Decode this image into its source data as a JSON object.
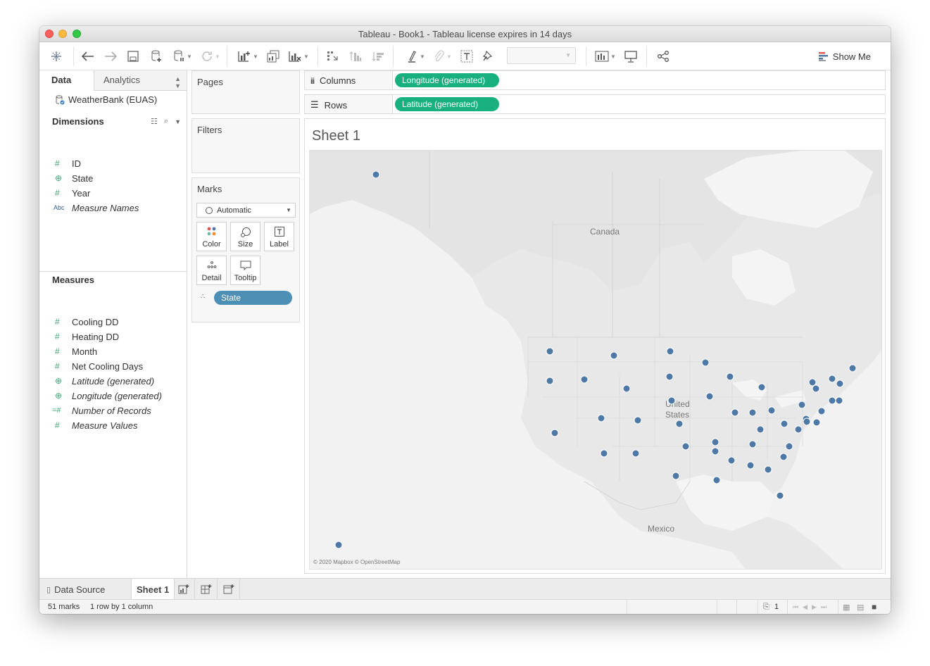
{
  "window": {
    "title": "Tableau - Book1 - Tableau license expires in 14 days"
  },
  "toolbar": {
    "show_me_label": "Show Me"
  },
  "datapane": {
    "tabs": {
      "data": "Data",
      "analytics": "Analytics"
    },
    "source": "WeatherBank (EUAS)",
    "dimensions_title": "Dimensions",
    "dimensions": [
      {
        "label": "ID",
        "icon": "number-icon"
      },
      {
        "label": "State",
        "icon": "globe-icon"
      },
      {
        "label": "Year",
        "icon": "number-icon"
      },
      {
        "label": "Measure Names",
        "icon": "abc-icon"
      }
    ],
    "measures_title": "Measures",
    "measures": [
      {
        "label": "Cooling DD",
        "icon": "number-icon"
      },
      {
        "label": "Heating DD",
        "icon": "number-icon"
      },
      {
        "label": "Month",
        "icon": "number-icon"
      },
      {
        "label": "Net Cooling Days",
        "icon": "number-icon"
      },
      {
        "label": "Latitude (generated)",
        "icon": "globe-icon"
      },
      {
        "label": "Longitude (generated)",
        "icon": "globe-icon"
      },
      {
        "label": "Number of Records",
        "icon": "calc-number-icon"
      },
      {
        "label": "Measure Values",
        "icon": "number-icon"
      }
    ]
  },
  "cards": {
    "pages": "Pages",
    "filters": "Filters",
    "marks": "Marks",
    "mark_type": "Automatic",
    "mark_buttons": {
      "color": "Color",
      "size": "Size",
      "label": "Label",
      "detail": "Detail",
      "tooltip": "Tooltip"
    },
    "detail_pill": "State"
  },
  "shelves": {
    "columns_label": "Columns",
    "columns_pill": "Longitude (generated)",
    "rows_label": "Rows",
    "rows_pill": "Latitude (generated)"
  },
  "viz": {
    "sheet_title": "Sheet 1",
    "map_labels": {
      "canada": "Canada",
      "us_line1": "United",
      "us_line2": "States",
      "mexico": "Mexico"
    },
    "attribution": "© 2020 Mapbox © OpenStreetMap",
    "mark_color": "#4e79a7"
  },
  "sheettabs": {
    "data_source": "Data Source",
    "sheet1": "Sheet 1"
  },
  "status": {
    "marks": "51 marks",
    "layout": "1 row by 1 column",
    "page": "1"
  },
  "colors": {
    "green_pill": "#18b07e",
    "blue_pill": "#4e8fb6"
  }
}
